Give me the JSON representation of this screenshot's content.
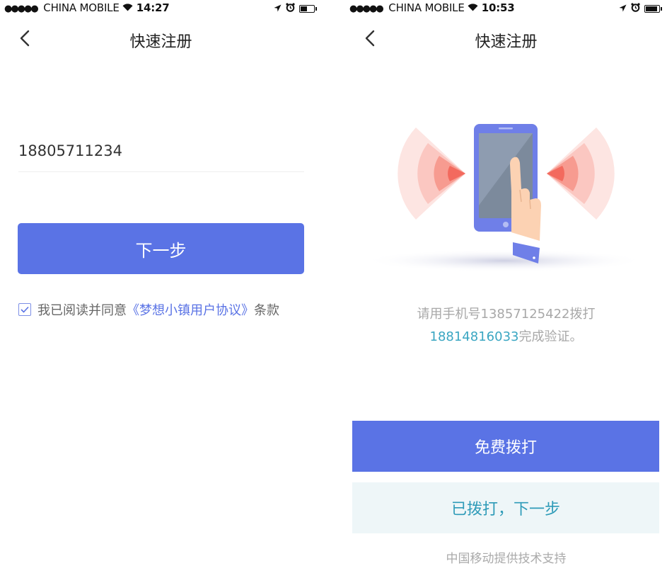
{
  "left_screen": {
    "status_bar": {
      "signal_dots": "●●●●●",
      "carrier": "CHINA MOBILE",
      "wifi_icon": "wifi-icon",
      "time": "14:27",
      "battery_level": 0.55
    },
    "nav": {
      "back_icon": "chevron-left-icon",
      "title": "快速注册"
    },
    "phone_value": "18805711234",
    "next_label": "下一步",
    "agreement": {
      "checked": true,
      "prefix": "我已阅读并同意",
      "link": "《梦想小镇用户协议》",
      "suffix": "条款"
    }
  },
  "right_screen": {
    "status_bar": {
      "signal_dots": "●●●●●",
      "carrier": "CHINA MOBILE",
      "wifi_icon": "wifi-icon",
      "time": "10:53",
      "battery_level": 0.95
    },
    "nav": {
      "back_icon": "chevron-left-icon",
      "title": "快速注册"
    },
    "illustration_icon": "phone-call-illustration",
    "instruction": {
      "line1": "请用手机号13857125422拨打",
      "number": "18814816033",
      "line2_suffix": "完成验证。"
    },
    "call_label": "免费拨打",
    "called_label": "已拨打，下一步",
    "footer": "中国移动提供技术支持"
  },
  "colors": {
    "primary": "#5a73e5",
    "teal": "#3aa6c2",
    "light_teal_bg": "#eef6f8",
    "wave_red": "#f36a5e",
    "hint_gray": "#a8a8a8"
  }
}
